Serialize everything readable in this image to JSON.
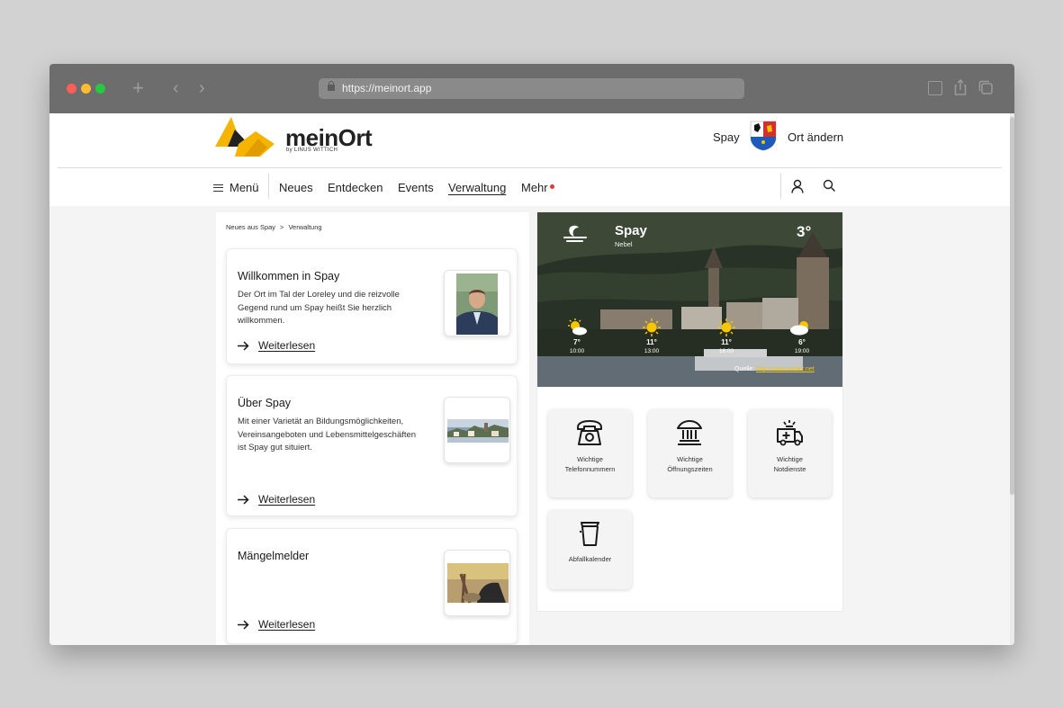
{
  "browser": {
    "url": "https://meinort.app"
  },
  "header": {
    "logo_text": "meinOrt",
    "logo_sub": "by LINUS WITTICH",
    "town": "Spay",
    "change_town": "Ort ändern"
  },
  "nav": {
    "menu": "Menü",
    "items": [
      "Neues",
      "Entdecken",
      "Events",
      "Verwaltung",
      "Mehr"
    ],
    "active": "Verwaltung"
  },
  "breadcrumb": {
    "parent": "Neues aus Spay",
    "separator": ">",
    "current": "Verwaltung"
  },
  "cards": [
    {
      "title": "Willkommen in Spay",
      "text": "Der Ort im Tal der Loreley und die reizvolle Gegend rund um Spay heißt Sie herzlich willkommen.",
      "link": "Weiterlesen",
      "thumb_icon": "portrait-photo"
    },
    {
      "title": "Über Spay",
      "text": "Mit einer Varietät an Bildungsmöglichkeiten, Vereinsangeboten und Lebensmittelgeschäften ist Spay gut situiert.",
      "link": "Weiterlesen",
      "thumb_icon": "village-photo"
    },
    {
      "title": "Mängelmelder",
      "text": "",
      "link": "Weiterlesen",
      "thumb_icon": "litter-photo"
    }
  ],
  "weather": {
    "town": "Spay",
    "condition": "Nebel",
    "temperature": "3°",
    "current_icon": "moon-fog-icon",
    "forecast": [
      {
        "temp": "7°",
        "time": "10:00",
        "icon": "sun-cloud-icon"
      },
      {
        "temp": "11°",
        "time": "13:00",
        "icon": "sun-icon"
      },
      {
        "temp": "11°",
        "time": "16:00",
        "icon": "sun-icon"
      },
      {
        "temp": "6°",
        "time": "19:00",
        "icon": "cloud-sun-icon"
      }
    ],
    "source_label": "Quelle:",
    "source_link": "http://www.wetter.net"
  },
  "tiles": [
    {
      "label_1": "Wichtige",
      "label_2": "Telefonnummern",
      "icon": "telephone-icon"
    },
    {
      "label_1": "Wichtige",
      "label_2": "Öffnungszeiten",
      "icon": "town-hall-icon"
    },
    {
      "label_1": "Wichtige",
      "label_2": "Notdienste",
      "icon": "ambulance-icon"
    },
    {
      "label_1": "Abfallkalender",
      "label_2": "",
      "icon": "waste-bin-icon"
    }
  ]
}
